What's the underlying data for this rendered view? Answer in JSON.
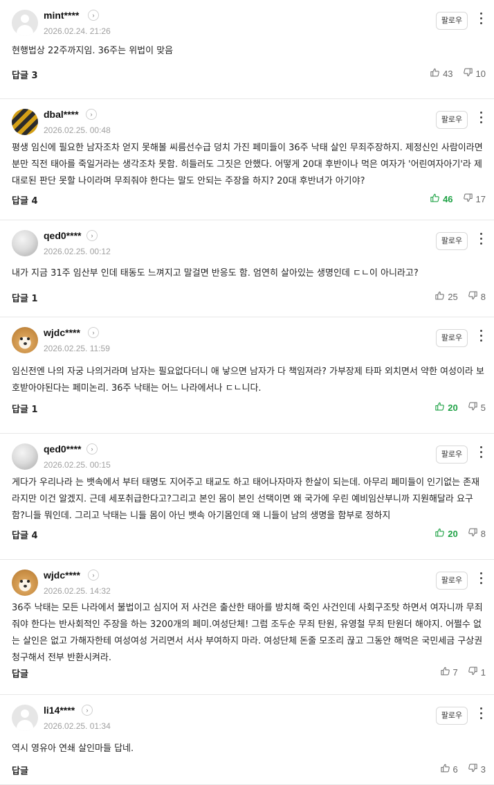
{
  "comments": [
    {
      "username": "mint****",
      "date": "2026.02.24. 21:26",
      "follow": "팔로우",
      "avatar": "default-avatar",
      "text": "현행법상 22주까지임. 36주는 위법이 맞음",
      "reply": "답글 3",
      "likes": "43",
      "dislikes": "10",
      "liked": false
    },
    {
      "username": "dbal****",
      "date": "2026.02.25. 00:48",
      "follow": "팔로우",
      "avatar": "striped-avatar",
      "text": "평생 임신에 필요한 남자조차 얻지 못해볼 씨름선수급 덩치 가진 페미들이 36주 낙태 살인 무죄주장하지. 제정신인 사람이라면 분만 직전 태아를 죽일거라는 생각조차 못함. 히들러도 그짓은 안했다. 어떻게 20대 후반이나 먹은 여자가 '어린여자아기'라 제대로된 판단 못할 나이라며 무죄줘야 한다는 말도 안되는 주장을 하지? 20대 후반녀가 아기야?",
      "reply": "답글 4",
      "likes": "46",
      "dislikes": "17",
      "liked": true
    },
    {
      "username": "qed0****",
      "date": "2026.02.25. 00:12",
      "follow": "팔로우",
      "avatar": "gray-avatar",
      "text": "내가 지금 31주 임산부 인데 태동도 느껴지고 말걸면 반응도 함. 엄연히 살아있는 생명인데 ㄷㄴ이 아니라고?",
      "reply": "답글 1",
      "likes": "25",
      "dislikes": "8",
      "liked": false
    },
    {
      "username": "wjdc****",
      "date": "2026.02.25. 11:59",
      "follow": "팔로우",
      "avatar": "dog-avatar",
      "text": "임신전엔 나의 자궁 나의거라며 남자는 필요없다더니 애 낳으면 남자가 다 책임져라? 가부장제 타파 외치면서 약한 여성이라 보호받아야된다는 페미논리. 36주 낙태는 어느 나라에서나 ㄷㄴ니다.",
      "reply": "답글 1",
      "likes": "20",
      "dislikes": "5",
      "liked": true
    },
    {
      "username": "qed0****",
      "date": "2026.02.25. 00:15",
      "follow": "팔로우",
      "avatar": "gray-avatar",
      "text": "게다가 우리나라 는 뱃속에서 부터 태명도 지어주고 태교도 하고 태어나자마자 한살이 되는데. 아무리 페미들이 인기없는 존재라지만 이건 알겠지. 근데 세포취급한다고?그리고 본인 몸이 본인 선택이면 왜 국가에 우린 예비임산부니까 지원해달라 요구함?니들 뭐인데. 그리고 낙태는 니들 몸이 아닌 뱃속 아기몸인데 왜 니들이 남의 생명을 함부로 정하지",
      "reply": "답글 4",
      "likes": "20",
      "dislikes": "8",
      "liked": true
    },
    {
      "username": "wjdc****",
      "date": "2026.02.25. 14:32",
      "follow": "팔로우",
      "avatar": "dog-avatar",
      "text": "36주 낙태는 모든 나라에서 불법이고 심지어 저 사건은 출산한 태아를 방치해 죽인 사건인데 사회구조탓 하면서 여자니까 무죄줘야 한다는 반사회적인 주장을 하는 3200개의 페미.여성단체! 그럼 조두순 무죄 탄원, 유영철 무죄 탄원더 해야지. 어쩔수 없는 살인은 없고 가해자한테 여성여성 거리면서 서사 부여하지 마라. 여성단체 돈줄 모조리 끊고 그동안 해먹은 국민세금 구상권 청구해서 전부 반환시켜라.",
      "reply": "답글",
      "likes": "7",
      "dislikes": "1",
      "liked": false
    },
    {
      "username": "li14****",
      "date": "2026.02.25. 01:34",
      "follow": "팔로우",
      "avatar": "default-avatar",
      "text": "역시 영유아 연쇄 살인마들 답네.",
      "reply": "답글",
      "likes": "6",
      "dislikes": "3",
      "liked": false
    }
  ]
}
